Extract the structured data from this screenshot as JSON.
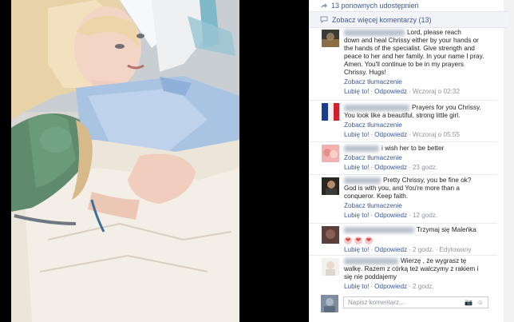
{
  "shares": {
    "icon": "share-icon",
    "text": "13 ponownych udostępnień"
  },
  "more_comments": {
    "icon": "comment-icon",
    "text": "Zobacz więcej komentarzy (13)"
  },
  "comments": [
    {
      "lines": [
        "Lord, please reach",
        "down and heal Chrissy either by your hands or",
        "the hands of the specialist. Give strength and",
        "peace to her and her family. In your name I pray.",
        "Amen. You'll continue to be in my prayers",
        "Chrissy. Hugs!"
      ],
      "translate": "Zobacz tłumaczenie",
      "like": "Lubię to!",
      "reply": "Odpowiedz",
      "time": "Wczoraj o 02:32"
    },
    {
      "lines": [
        "Prayers for you Chrissy.",
        "You look like a beautiful, strong little girl."
      ],
      "translate": "Zobacz tłumaczenie",
      "like": "Lubię to!",
      "reply": "Odpowiedz",
      "time": "Wczoraj o 05:55"
    },
    {
      "lines": [
        "i wish her to be better"
      ],
      "translate": "Zobacz tłumaczenie",
      "like": "Lubię to!",
      "reply": "Odpowiedz",
      "time": "23 godz."
    },
    {
      "lines": [
        "Pretty Chrissy, you be fine ok?",
        "God is with you, and You're more than a",
        "conqueror. Keep faith."
      ],
      "translate": "Zobacz tłumaczenie",
      "like": "Lubię to!",
      "reply": "Odpowiedz",
      "time": "12 godz."
    },
    {
      "lines": [
        "Trzymaj się Maleńka"
      ],
      "hearts": [
        "❤",
        "❤",
        "❤"
      ],
      "like": "Lubię to!",
      "reply": "Odpowiedz",
      "time": "2 godz.",
      "edited": "Edytowany"
    },
    {
      "lines": [
        "Wierzę , że wygrasz tę",
        "walkę. Razem z córką też walczymy z rakiem i",
        "się nie poddajemy"
      ],
      "like": "Lubię to!",
      "reply": "Odpowiedz",
      "time": "2 godz."
    }
  ],
  "write_comment": {
    "placeholder": "Napisz komentarz...",
    "camera_icon": "camera-icon",
    "emoji_icon": "emoji-icon"
  },
  "colors": {
    "link": "#3b5998",
    "muted": "#90949c",
    "text": "#222222",
    "panel_bg": "#f2f4f8"
  }
}
